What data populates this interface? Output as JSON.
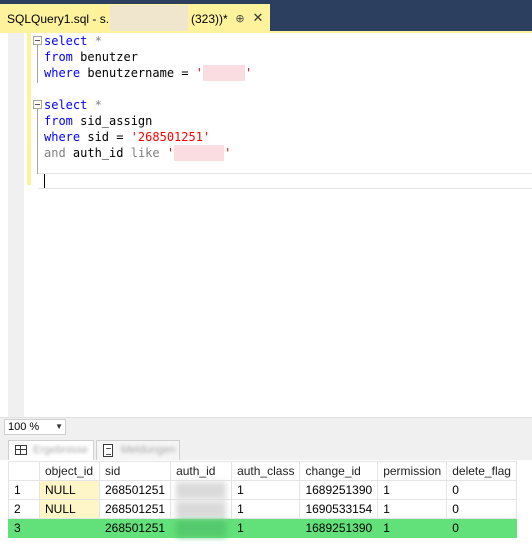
{
  "document_tab": {
    "title_prefix": "SQLQuery1.sql - s...",
    "title_suffix": "(323))*",
    "pin_glyph": "⊕",
    "close_glyph": "✕"
  },
  "editor": {
    "lines": [
      {
        "kw": "select",
        "rest": " *"
      },
      {
        "kw": "from",
        "rest": " benutzer"
      },
      {
        "kw": "where",
        "rest": " benutzername = ",
        "str": "'",
        "str_end": "'"
      },
      {
        "kw": "select",
        "rest": " *"
      },
      {
        "kw": "from",
        "rest": " sid_assign"
      },
      {
        "kw": "where",
        "rest": " sid = ",
        "str": "'268501251'"
      },
      {
        "kw": "and",
        "rest": " auth_id ",
        "kw2": "like",
        "str": " '",
        "str_end": "'"
      }
    ]
  },
  "zoom": {
    "value": "100 %"
  },
  "result_tabs": {
    "results_label": "Ergebnisse",
    "messages_label": "Meldungen"
  },
  "grid": {
    "columns": [
      "",
      "object_id",
      "sid",
      "auth_id",
      "auth_class",
      "change_id",
      "permission",
      "delete_flag"
    ],
    "rows": [
      {
        "n": "1",
        "object_id": "NULL",
        "sid": "268501251",
        "auth_class": "1",
        "change_id": "1689251390",
        "permission": "1",
        "delete_flag": "0"
      },
      {
        "n": "2",
        "object_id": "NULL",
        "sid": "268501251",
        "auth_class": "1",
        "change_id": "1690533154",
        "permission": "1",
        "delete_flag": "0"
      },
      {
        "n": "3",
        "object_id": "",
        "sid": "268501251",
        "auth_class": "1",
        "change_id": "1689251390",
        "permission": "1",
        "delete_flag": "0"
      }
    ],
    "selected_row_color": "#62e07a"
  }
}
